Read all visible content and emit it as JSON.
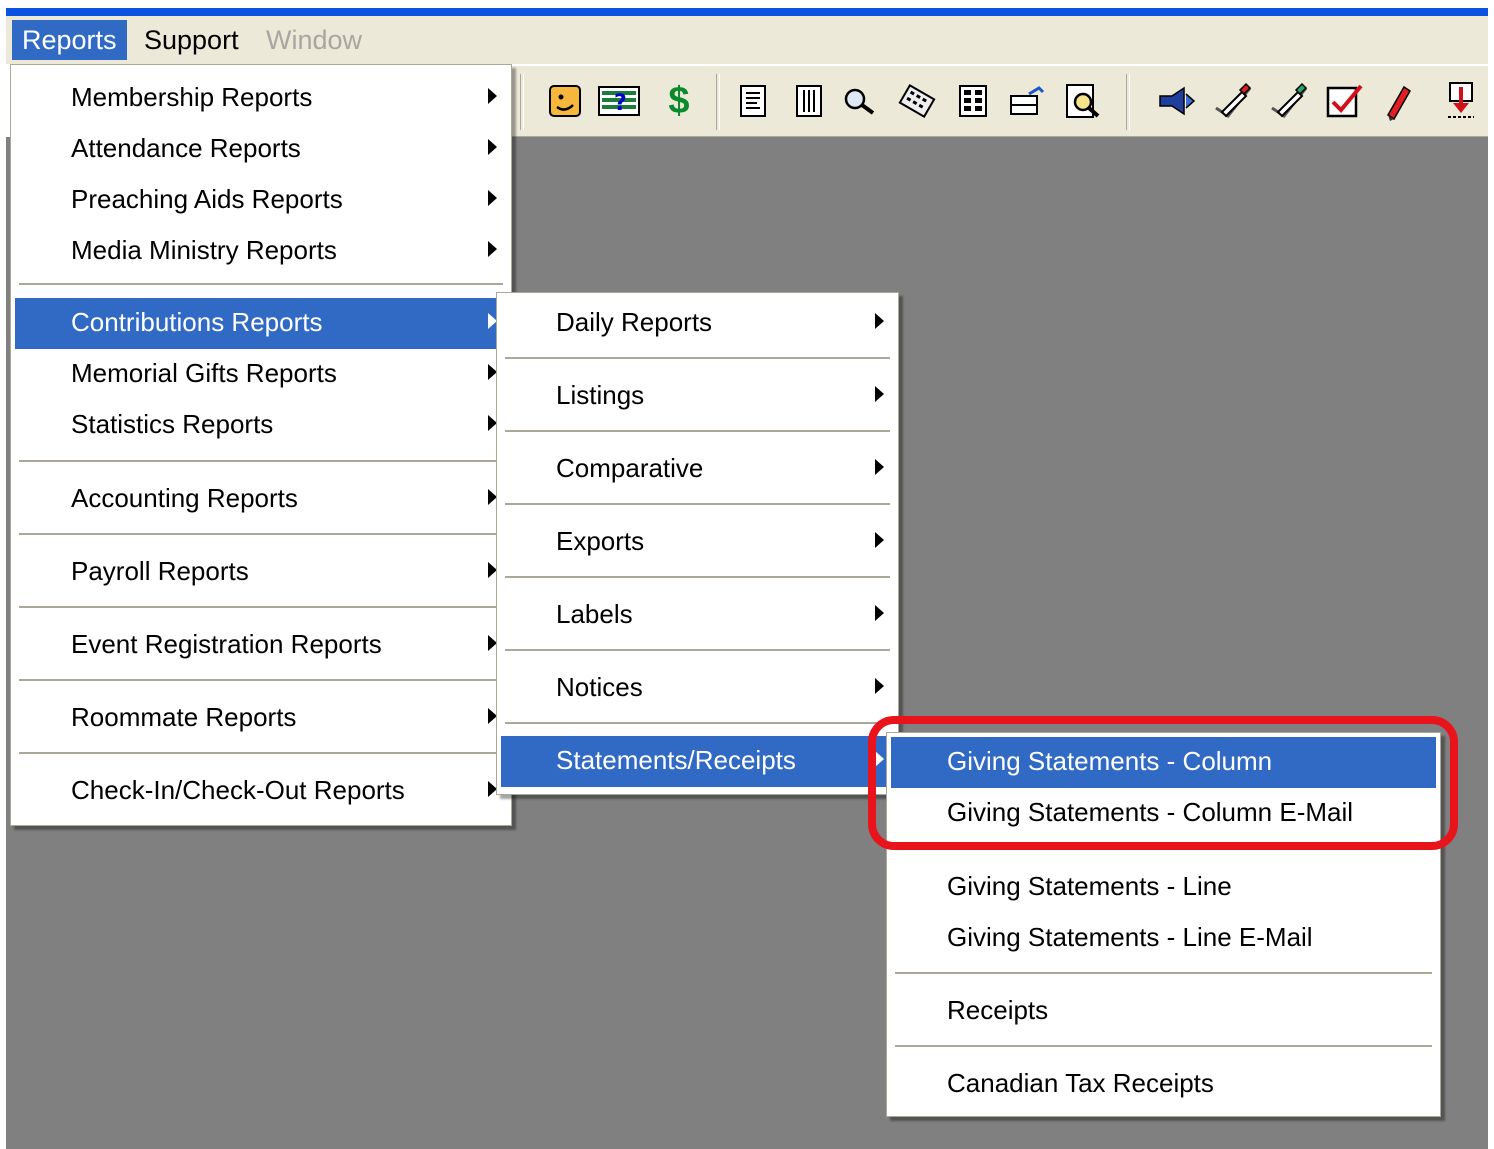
{
  "menubar": {
    "items": [
      {
        "label": "Reports"
      },
      {
        "label": "Support"
      },
      {
        "label": "Window"
      }
    ]
  },
  "toolbar": {
    "icons": [
      "face-card-icon",
      "question-board-icon",
      "dollar-icon",
      "list-icon",
      "grid-list-icon",
      "search-icon",
      "calculator-icon",
      "keypad-icon",
      "cabinet-icon",
      "preview-icon",
      "speaker-icon",
      "pen-check-icon",
      "pen-check-2-icon",
      "checkbox-icon",
      "red-pencil-icon",
      "download-icon"
    ],
    "dollar_glyph": "$"
  },
  "reports_menu": {
    "items": [
      {
        "label": "Membership Reports"
      },
      {
        "label": "Attendance Reports"
      },
      {
        "label": "Preaching Aids Reports"
      },
      {
        "label": "Media Ministry Reports"
      },
      {
        "label": "Contributions Reports"
      },
      {
        "label": "Memorial Gifts Reports"
      },
      {
        "label": "Statistics Reports"
      },
      {
        "label": "Accounting Reports"
      },
      {
        "label": "Payroll Reports"
      },
      {
        "label": "Event Registration Reports"
      },
      {
        "label": "Roommate Reports"
      },
      {
        "label": "Check-In/Check-Out Reports"
      }
    ]
  },
  "contributions_menu": {
    "items": [
      {
        "label": "Daily Reports"
      },
      {
        "label": "Listings"
      },
      {
        "label": "Comparative"
      },
      {
        "label": "Exports"
      },
      {
        "label": "Labels"
      },
      {
        "label": "Notices"
      },
      {
        "label": "Statements/Receipts"
      }
    ]
  },
  "statements_menu": {
    "items": [
      {
        "label": "Giving Statements - Column"
      },
      {
        "label": "Giving Statements - Column E-Mail"
      },
      {
        "label": "Giving Statements - Line"
      },
      {
        "label": "Giving Statements - Line E-Mail"
      },
      {
        "label": "Receipts"
      },
      {
        "label": "Canadian Tax Receipts"
      }
    ]
  },
  "colors": {
    "menu_highlight": "#316ac5",
    "annotation_ring": "#e8131b",
    "workspace": "#808080",
    "chrome": "#ece9d8"
  }
}
